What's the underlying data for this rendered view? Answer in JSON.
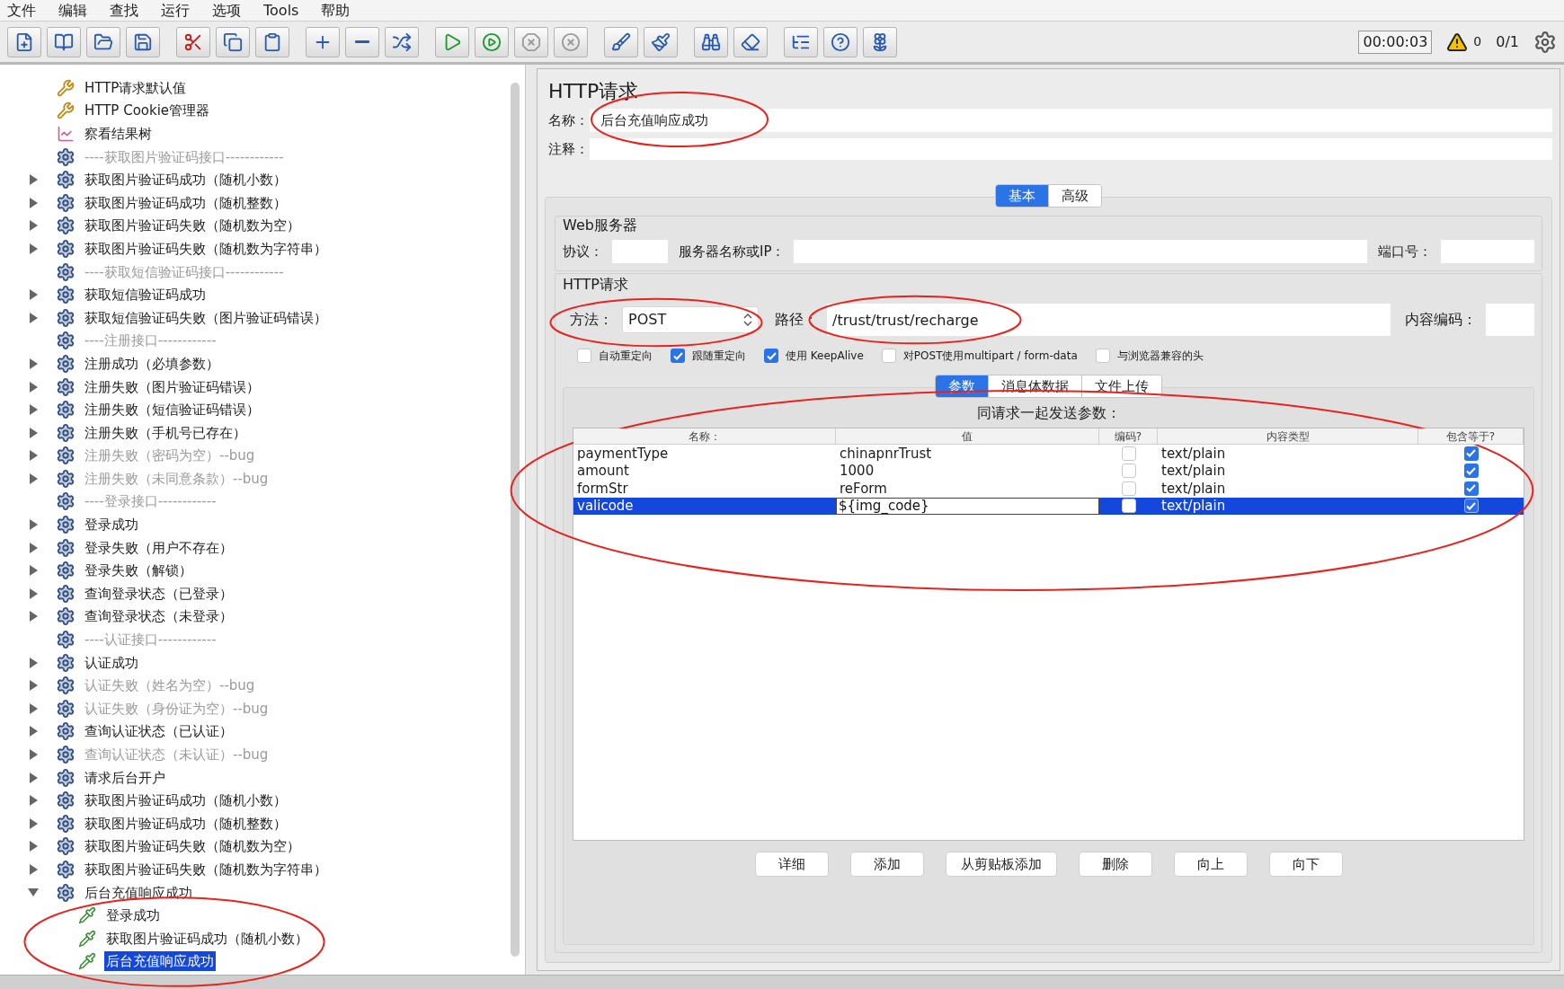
{
  "menu": [
    "文件",
    "编辑",
    "查找",
    "运行",
    "选项",
    "Tools",
    "帮助"
  ],
  "toolbar_status": {
    "timer": "00:00:03",
    "warnings": "0",
    "threads": "0/1"
  },
  "tree": [
    {
      "label": "HTTP请求默认值",
      "kind": "tool",
      "disabled": false,
      "selected": false
    },
    {
      "label": "HTTP Cookie管理器",
      "kind": "tool",
      "disabled": false,
      "selected": false
    },
    {
      "label": "察看结果树",
      "kind": "listener",
      "disabled": false,
      "selected": false
    },
    {
      "label": "----获取图片验证码接口------------",
      "kind": "sampler",
      "disabled": true,
      "selected": false
    },
    {
      "label": "获取图片验证码成功（随机小数）",
      "kind": "sampler",
      "expanded": false,
      "disabled": false,
      "selected": false
    },
    {
      "label": "获取图片验证码成功（随机整数）",
      "kind": "sampler",
      "expanded": false,
      "disabled": false,
      "selected": false
    },
    {
      "label": "获取图片验证码失败（随机数为空）",
      "kind": "sampler",
      "expanded": false,
      "disabled": false,
      "selected": false
    },
    {
      "label": "获取图片验证码失败（随机数为字符串）",
      "kind": "sampler",
      "expanded": false,
      "disabled": false,
      "selected": false
    },
    {
      "label": "----获取短信验证码接口------------",
      "kind": "sampler",
      "disabled": true,
      "selected": false
    },
    {
      "label": "获取短信验证码成功",
      "kind": "sampler",
      "expanded": false,
      "disabled": false,
      "selected": false
    },
    {
      "label": "获取短信验证码失败（图片验证码错误）",
      "kind": "sampler",
      "expanded": false,
      "disabled": false,
      "selected": false
    },
    {
      "label": "----注册接口------------",
      "kind": "sampler",
      "disabled": true,
      "selected": false
    },
    {
      "label": "注册成功（必填参数）",
      "kind": "sampler",
      "expanded": false,
      "disabled": false,
      "selected": false
    },
    {
      "label": "注册失败（图片验证码错误）",
      "kind": "sampler",
      "expanded": false,
      "disabled": false,
      "selected": false
    },
    {
      "label": "注册失败（短信验证码错误）",
      "kind": "sampler",
      "expanded": false,
      "disabled": false,
      "selected": false
    },
    {
      "label": "注册失败（手机号已存在）",
      "kind": "sampler",
      "expanded": false,
      "disabled": false,
      "selected": false
    },
    {
      "label": "注册失败（密码为空）--bug",
      "kind": "sampler",
      "expanded": false,
      "disabled": true,
      "selected": false
    },
    {
      "label": "注册失败（未同意条款）--bug",
      "kind": "sampler",
      "expanded": false,
      "disabled": true,
      "selected": false
    },
    {
      "label": "----登录接口------------",
      "kind": "sampler",
      "disabled": true,
      "selected": false
    },
    {
      "label": "登录成功",
      "kind": "sampler",
      "expanded": false,
      "disabled": false,
      "selected": false
    },
    {
      "label": "登录失败（用户不存在）",
      "kind": "sampler",
      "expanded": false,
      "disabled": false,
      "selected": false
    },
    {
      "label": "登录失败（解锁）",
      "kind": "sampler",
      "expanded": false,
      "disabled": false,
      "selected": false
    },
    {
      "label": "查询登录状态（已登录）",
      "kind": "sampler",
      "expanded": false,
      "disabled": false,
      "selected": false
    },
    {
      "label": "查询登录状态（未登录）",
      "kind": "sampler",
      "expanded": false,
      "disabled": false,
      "selected": false
    },
    {
      "label": "----认证接口------------",
      "kind": "sampler",
      "disabled": true,
      "selected": false
    },
    {
      "label": "认证成功",
      "kind": "sampler",
      "expanded": false,
      "disabled": false,
      "selected": false
    },
    {
      "label": "认证失败（姓名为空）--bug",
      "kind": "sampler",
      "expanded": false,
      "disabled": true,
      "selected": false
    },
    {
      "label": "认证失败（身份证为空）--bug",
      "kind": "sampler",
      "expanded": false,
      "disabled": true,
      "selected": false
    },
    {
      "label": "查询认证状态（已认证）",
      "kind": "sampler",
      "expanded": false,
      "disabled": false,
      "selected": false
    },
    {
      "label": "查询认证状态（未认证）--bug",
      "kind": "sampler",
      "expanded": false,
      "disabled": true,
      "selected": false
    },
    {
      "label": "请求后台开户",
      "kind": "sampler",
      "expanded": false,
      "disabled": false,
      "selected": false
    },
    {
      "label": "获取图片验证码成功（随机小数）",
      "kind": "sampler",
      "expanded": false,
      "disabled": false,
      "selected": false
    },
    {
      "label": "获取图片验证码成功（随机整数）",
      "kind": "sampler",
      "expanded": false,
      "disabled": false,
      "selected": false
    },
    {
      "label": "获取图片验证码失败（随机数为空）",
      "kind": "sampler",
      "expanded": false,
      "disabled": false,
      "selected": false
    },
    {
      "label": "获取图片验证码失败（随机数为字符串）",
      "kind": "sampler",
      "expanded": false,
      "disabled": false,
      "selected": false
    },
    {
      "label": "后台充值响应成功",
      "kind": "sampler",
      "expanded": true,
      "disabled": false,
      "selected": false,
      "children_circled": true,
      "children": [
        {
          "label": "登录成功",
          "kind": "extractor",
          "disabled": false,
          "selected": false
        },
        {
          "label": "获取图片验证码成功（随机小数）",
          "kind": "extractor",
          "disabled": false,
          "selected": false
        },
        {
          "label": "后台充值响应成功",
          "kind": "extractor",
          "disabled": false,
          "selected": true
        }
      ]
    }
  ],
  "panel": {
    "title": "HTTP请求",
    "name": {
      "label": "名称：",
      "value": "后台充值响应成功",
      "circled": true
    },
    "comment": {
      "label": "注释："
    },
    "tabs": [
      {
        "label": "基本",
        "selected": true
      },
      {
        "label": "高级",
        "selected": false
      }
    ],
    "web_server": {
      "legend": "Web服务器",
      "protocol_label": "协议：",
      "server_label": "服务器名称或IP：",
      "port_label": "端口号："
    },
    "http_request": {
      "legend": "HTTP请求",
      "method": {
        "label": "方法：",
        "value": "POST",
        "circled": true
      },
      "path": {
        "label": "路径：",
        "value": "/trust/trust/recharge",
        "circled": true
      },
      "encoding_label": "内容编码：",
      "options": [
        {
          "label": "自动重定向",
          "checked": false
        },
        {
          "label": "跟随重定向",
          "checked": true
        },
        {
          "label": "使用 KeepAlive",
          "checked": true
        },
        {
          "label": "对POST使用multipart / form-data",
          "checked": false
        },
        {
          "label": "与浏览器兼容的头",
          "checked": false
        }
      ]
    },
    "sub_tabs": [
      {
        "label": "参数",
        "selected": true
      },
      {
        "label": "消息体数据",
        "selected": false
      },
      {
        "label": "文件上传",
        "selected": false
      }
    ],
    "params": {
      "heading": "同请求一起发送参数：",
      "circled": true,
      "columns": [
        "名称：",
        "值",
        "编码?",
        "内容类型",
        "包含等于?"
      ],
      "rows": [
        {
          "name": "paymentType",
          "value": "chinapnrTrust",
          "encoded": false,
          "content_type": "text/plain",
          "include_equals": true,
          "selected": false
        },
        {
          "name": "amount",
          "value": "1000",
          "encoded": false,
          "content_type": "text/plain",
          "include_equals": true,
          "selected": false
        },
        {
          "name": "formStr",
          "value": "reForm",
          "encoded": false,
          "content_type": "text/plain",
          "include_equals": true,
          "selected": false
        },
        {
          "name": "valicode",
          "value": "${img_code}",
          "encoded": false,
          "content_type": "text/plain",
          "include_equals": true,
          "selected": true
        }
      ]
    },
    "buttons": [
      "详细",
      "添加",
      "从剪贴板添加",
      "删除",
      "向上",
      "向下"
    ]
  }
}
